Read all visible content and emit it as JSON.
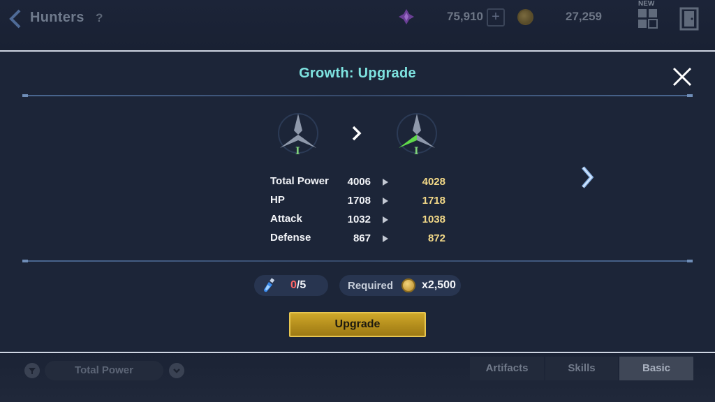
{
  "header": {
    "title": "Hunters",
    "help": "?",
    "gems": "75,910",
    "plus": "+",
    "gold": "27,259",
    "new_badge": "NEW"
  },
  "modal": {
    "title": "Growth: Upgrade",
    "rank_current": "I",
    "rank_next": "I",
    "stats": [
      {
        "label": "Total Power",
        "current": "4006",
        "next": "4028"
      },
      {
        "label": "HP",
        "current": "1708",
        "next": "1718"
      },
      {
        "label": "Attack",
        "current": "1032",
        "next": "1038"
      },
      {
        "label": "Defense",
        "current": "867",
        "next": "872"
      }
    ],
    "material": {
      "have": "0",
      "need": "/5"
    },
    "required": {
      "label": "Required",
      "amount": "x2,500"
    },
    "upgrade_button": "Upgrade"
  },
  "footer": {
    "sort_label": "Total Power",
    "tabs": [
      "Artifacts",
      "Skills",
      "Basic"
    ],
    "active_tab": "Basic"
  },
  "colors": {
    "title_cyan": "#7ee3e0",
    "new_value_gold": "#f3d988",
    "shortfall_red": "#ff6666",
    "button_gold": "#cfa82a"
  }
}
